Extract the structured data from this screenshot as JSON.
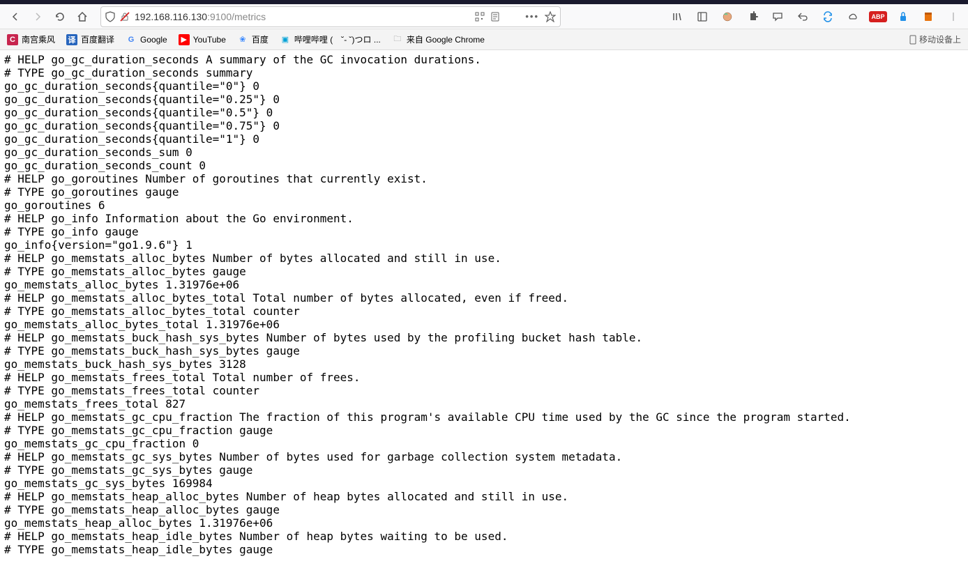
{
  "url": {
    "prefix": "192.168.116.130",
    "port": ":9100",
    "path": "/metrics"
  },
  "bookmarks": [
    {
      "icon": "red",
      "glyph": "C",
      "label": "南宫乘风"
    },
    {
      "icon": "blue",
      "glyph": "译",
      "label": "百度翻译"
    },
    {
      "icon": "goog",
      "glyph": "G",
      "label": "Google"
    },
    {
      "icon": "yt",
      "glyph": "▶",
      "label": "YouTube"
    },
    {
      "icon": "paw",
      "glyph": "❀",
      "label": "百度"
    },
    {
      "icon": "bili",
      "glyph": "▣",
      "label": "哔哩哔哩 (　˘- ˘)つロ ..."
    },
    {
      "icon": "folder",
      "glyph": "🗀",
      "label": "来自 Google Chrome"
    }
  ],
  "mobile_label": "移动设备上",
  "metrics": [
    "# HELP go_gc_duration_seconds A summary of the GC invocation durations.",
    "# TYPE go_gc_duration_seconds summary",
    "go_gc_duration_seconds{quantile=\"0\"} 0",
    "go_gc_duration_seconds{quantile=\"0.25\"} 0",
    "go_gc_duration_seconds{quantile=\"0.5\"} 0",
    "go_gc_duration_seconds{quantile=\"0.75\"} 0",
    "go_gc_duration_seconds{quantile=\"1\"} 0",
    "go_gc_duration_seconds_sum 0",
    "go_gc_duration_seconds_count 0",
    "# HELP go_goroutines Number of goroutines that currently exist.",
    "# TYPE go_goroutines gauge",
    "go_goroutines 6",
    "# HELP go_info Information about the Go environment.",
    "# TYPE go_info gauge",
    "go_info{version=\"go1.9.6\"} 1",
    "# HELP go_memstats_alloc_bytes Number of bytes allocated and still in use.",
    "# TYPE go_memstats_alloc_bytes gauge",
    "go_memstats_alloc_bytes 1.31976e+06",
    "# HELP go_memstats_alloc_bytes_total Total number of bytes allocated, even if freed.",
    "# TYPE go_memstats_alloc_bytes_total counter",
    "go_memstats_alloc_bytes_total 1.31976e+06",
    "# HELP go_memstats_buck_hash_sys_bytes Number of bytes used by the profiling bucket hash table.",
    "# TYPE go_memstats_buck_hash_sys_bytes gauge",
    "go_memstats_buck_hash_sys_bytes 3128",
    "# HELP go_memstats_frees_total Total number of frees.",
    "# TYPE go_memstats_frees_total counter",
    "go_memstats_frees_total 827",
    "# HELP go_memstats_gc_cpu_fraction The fraction of this program's available CPU time used by the GC since the program started.",
    "# TYPE go_memstats_gc_cpu_fraction gauge",
    "go_memstats_gc_cpu_fraction 0",
    "# HELP go_memstats_gc_sys_bytes Number of bytes used for garbage collection system metadata.",
    "# TYPE go_memstats_gc_sys_bytes gauge",
    "go_memstats_gc_sys_bytes 169984",
    "# HELP go_memstats_heap_alloc_bytes Number of heap bytes allocated and still in use.",
    "# TYPE go_memstats_heap_alloc_bytes gauge",
    "go_memstats_heap_alloc_bytes 1.31976e+06",
    "# HELP go_memstats_heap_idle_bytes Number of heap bytes waiting to be used.",
    "# TYPE go_memstats_heap_idle_bytes gauge"
  ]
}
